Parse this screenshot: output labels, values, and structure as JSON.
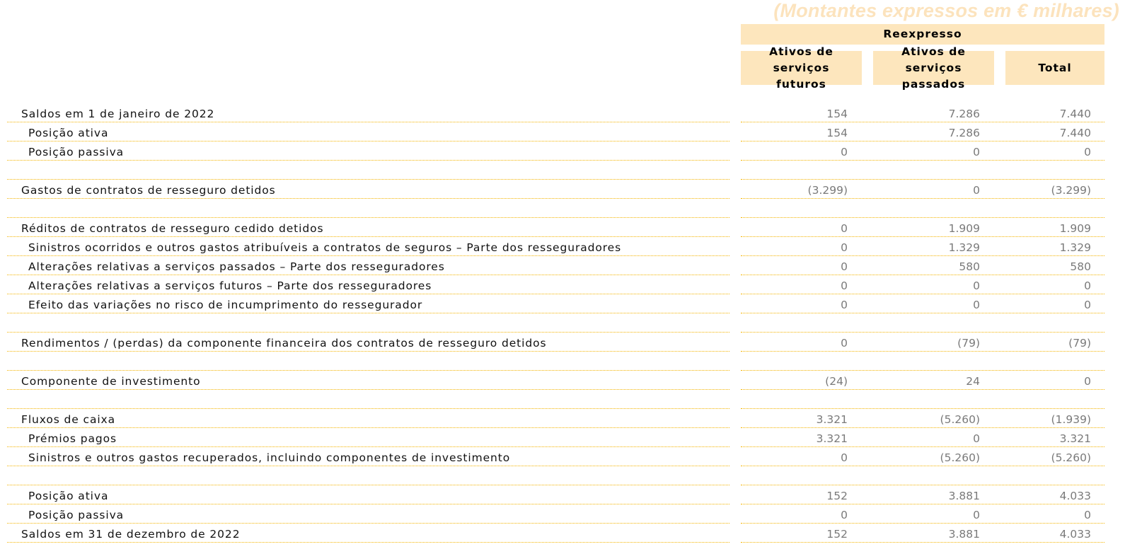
{
  "units_note": "(Montantes expressos em € milhares)",
  "header": {
    "group_label": "Reexpresso",
    "columns": [
      {
        "line1": "Ativos de serviços",
        "line2": "futuros"
      },
      {
        "line1": "Ativos de serviços",
        "line2": "passados"
      },
      {
        "line1": "Total",
        "line2": ""
      }
    ]
  },
  "rows": [
    {
      "label": "Saldos em 1 de janeiro de 2022",
      "indent": 1,
      "values": [
        "154",
        "7.286",
        "7.440"
      ]
    },
    {
      "label": "Posição ativa",
      "indent": 2,
      "values": [
        "154",
        "7.286",
        "7.440"
      ]
    },
    {
      "label": "Posição passiva",
      "indent": 2,
      "values": [
        "0",
        "0",
        "0"
      ]
    },
    {
      "label": "",
      "indent": 1,
      "values": [
        "",
        "",
        ""
      ]
    },
    {
      "label": "Gastos de contratos de resseguro detidos",
      "indent": 1,
      "values": [
        "(3.299)",
        "0",
        "(3.299)"
      ]
    },
    {
      "label": "",
      "indent": 1,
      "values": [
        "",
        "",
        ""
      ]
    },
    {
      "label": "Réditos de contratos de resseguro cedido detidos",
      "indent": 1,
      "values": [
        "0",
        "1.909",
        "1.909"
      ]
    },
    {
      "label": "Sinistros ocorridos e outros gastos atribuíveis a contratos de seguros – Parte dos resseguradores",
      "indent": 2,
      "values": [
        "0",
        "1.329",
        "1.329"
      ]
    },
    {
      "label": "Alterações relativas a serviços passados – Parte dos resseguradores",
      "indent": 2,
      "values": [
        "0",
        "580",
        "580"
      ]
    },
    {
      "label": "Alterações relativas a serviços futuros – Parte dos resseguradores",
      "indent": 2,
      "values": [
        "0",
        "0",
        "0"
      ]
    },
    {
      "label": "Efeito das variações no risco de incumprimento do ressegurador",
      "indent": 2,
      "values": [
        "0",
        "0",
        "0"
      ]
    },
    {
      "label": "",
      "indent": 1,
      "values": [
        "",
        "",
        ""
      ]
    },
    {
      "label": "Rendimentos / (perdas) da componente financeira dos contratos de resseguro detidos",
      "indent": 1,
      "values": [
        "0",
        "(79)",
        "(79)"
      ]
    },
    {
      "label": "",
      "indent": 1,
      "values": [
        "",
        "",
        ""
      ]
    },
    {
      "label": "Componente de investimento",
      "indent": 1,
      "values": [
        "(24)",
        "24",
        "0"
      ]
    },
    {
      "label": "",
      "indent": 1,
      "values": [
        "",
        "",
        ""
      ]
    },
    {
      "label": "Fluxos de caixa",
      "indent": 1,
      "values": [
        "3.321",
        "(5.260)",
        "(1.939)"
      ]
    },
    {
      "label": "Prémios pagos",
      "indent": 2,
      "values": [
        "3.321",
        "0",
        "3.321"
      ]
    },
    {
      "label": "Sinistros e outros gastos recuperados, incluindo componentes de investimento",
      "indent": 2,
      "values": [
        "0",
        "(5.260)",
        "(5.260)"
      ]
    },
    {
      "label": "",
      "indent": 1,
      "values": [
        "",
        "",
        ""
      ]
    },
    {
      "label": "Posição ativa",
      "indent": 2,
      "values": [
        "152",
        "3.881",
        "4.033"
      ]
    },
    {
      "label": "Posição passiva",
      "indent": 2,
      "values": [
        "0",
        "0",
        "0"
      ]
    },
    {
      "label": "Saldos em 31 de dezembro de 2022",
      "indent": 1,
      "values": [
        "152",
        "3.881",
        "4.033"
      ]
    }
  ]
}
